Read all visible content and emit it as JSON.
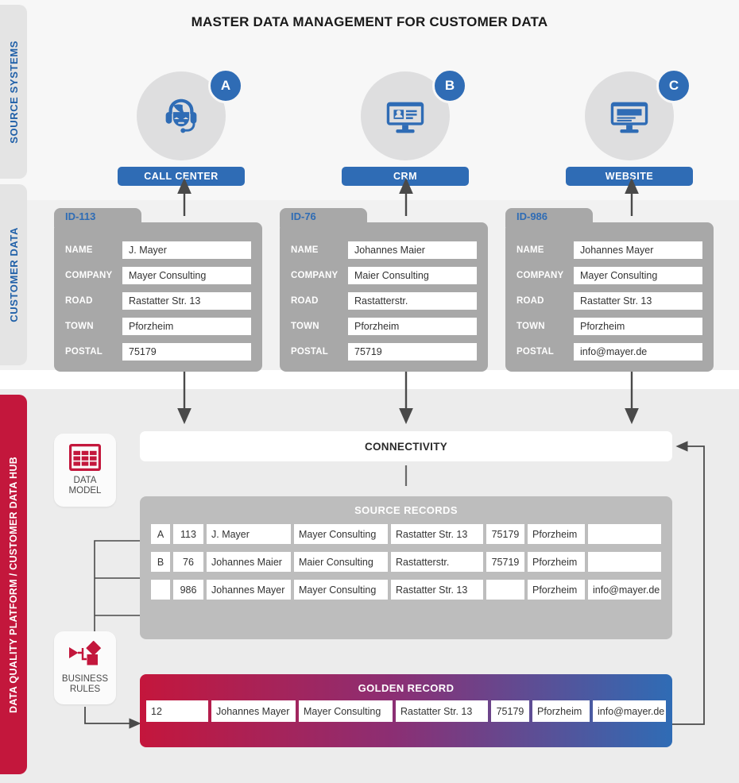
{
  "title": "MASTER DATA MANAGEMENT FOR CUSTOMER DATA",
  "sidebar": {
    "source_systems": "SOURCE SYSTEMS",
    "customer_data": "CUSTOMER DATA",
    "data_hub": "DATA QUALITY PLATFORM / CUSTOMER DATA HUB"
  },
  "colors": {
    "blue": "#2f6cb5",
    "red": "#c3173c",
    "card_gray": "#a8a8a8",
    "panel_gray": "#bdbdbd"
  },
  "sources": [
    {
      "badge": "A",
      "label": "CALL CENTER",
      "icon": "headset-agent-icon"
    },
    {
      "badge": "B",
      "label": "CRM",
      "icon": "contact-card-monitor-icon"
    },
    {
      "badge": "C",
      "label": "WEBSITE",
      "icon": "website-monitor-icon"
    }
  ],
  "field_labels": {
    "name": "NAME",
    "company": "COMPANY",
    "road": "ROAD",
    "town": "TOWN",
    "postal": "POSTAL"
  },
  "customer_cards": [
    {
      "id": "ID-113",
      "name": "J. Mayer",
      "company": "Mayer Consulting",
      "road": "Rastatter Str. 13",
      "town": "Pforzheim",
      "postal": "75179"
    },
    {
      "id": "ID-76",
      "name": "Johannes Maier",
      "company": "Maier Consulting",
      "road": "Rastatterstr.",
      "town": "Pforzheim",
      "postal": "75719"
    },
    {
      "id": "ID-986",
      "name": "Johannes Mayer",
      "company": "Mayer Consulting",
      "road": "Rastatter Str. 13",
      "town": "Pforzheim",
      "postal": "info@mayer.de"
    }
  ],
  "hub": {
    "data_model_line1": "DATA",
    "data_model_line2": "MODEL",
    "business_rules_line1": "BUSINESS",
    "business_rules_line2": "RULES",
    "connectivity": "CONNECTIVITY",
    "source_records_title": "SOURCE RECORDS",
    "golden_record_title": "GOLDEN RECORD"
  },
  "source_records": [
    {
      "source": "A",
      "id": "113",
      "name": "J. Mayer",
      "company": "Mayer Consulting",
      "road": "Rastatter Str. 13",
      "postal": "75179",
      "town": "Pforzheim",
      "email": ""
    },
    {
      "source": "B",
      "id": "76",
      "name": "Johannes Maier",
      "company": "Maier Consulting",
      "road": "Rastatterstr.",
      "postal": "75719",
      "town": "Pforzheim",
      "email": ""
    },
    {
      "source": "",
      "id": "986",
      "name": "Johannes Mayer",
      "company": "Mayer Consulting",
      "road": "Rastatter Str. 13",
      "postal": "",
      "town": "Pforzheim",
      "email": "info@mayer.de"
    }
  ],
  "golden_record": {
    "id": "12",
    "name": "Johannes Mayer",
    "company": "Mayer Consulting",
    "road": "Rastatter Str. 13",
    "postal": "75179",
    "town": "Pforzheim",
    "email": "info@mayer.de"
  }
}
